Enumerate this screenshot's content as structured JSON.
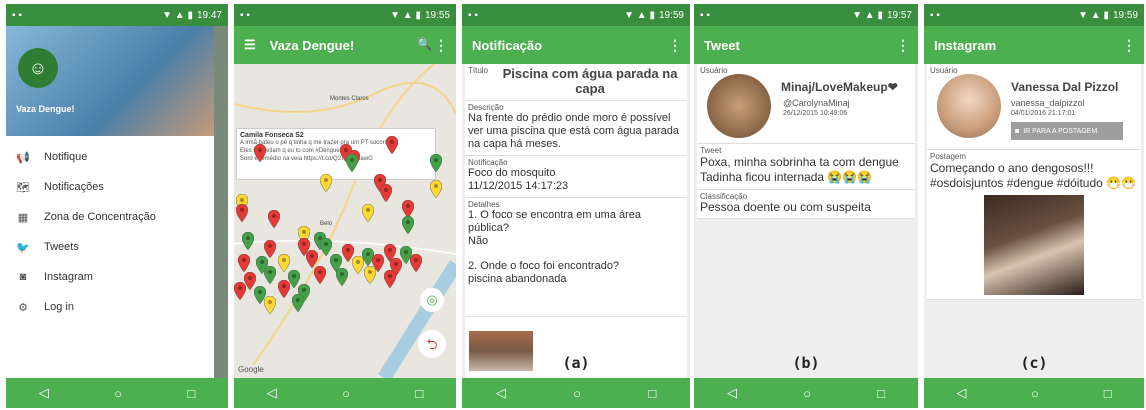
{
  "status_times": [
    "19:47",
    "19:55",
    "19:59",
    "19:57",
    "19:59"
  ],
  "drawer": {
    "app_name": "Vaza Dengue!",
    "items": [
      {
        "label": "Notifique",
        "icon": "megaphone-icon"
      },
      {
        "label": "Notificações",
        "icon": "map-list-icon"
      },
      {
        "label": "Zona de Concentração",
        "icon": "zone-map-icon"
      },
      {
        "label": "Tweets",
        "icon": "twitter-icon"
      },
      {
        "label": "Instagram",
        "icon": "instagram-icon"
      },
      {
        "label": "Log in",
        "icon": "gear-icon"
      }
    ]
  },
  "map_screen": {
    "title": "Vaza Dengue!",
    "tooltip_user": "Camila Fonseca S2",
    "tooltip_text": "A irmã bateu o pé q tinha q me trazer pra um PT socorro\nEles suspeitam q eu to com #Dengue\nSoro e remédio na veia https://t.co/Q276YGEawG",
    "city_label": "Montes Claros",
    "city_label2": "Belo"
  },
  "notification": {
    "title": "Notificação",
    "titulo_label": "Título",
    "titulo": "Piscina com água parada na capa",
    "descricao_label": "Descrição",
    "descricao": "Na frente do prédio onde moro é possível ver uma piscina que está com água parada na capa há meses.",
    "notificacao_label": "Notificação",
    "notificacao_type": "Foco do mosquito",
    "notificacao_date": "11/12/2015 14:17:23",
    "detalhes_label": "Detalhes",
    "detalhe_q1": "1. O foco se encontra em uma área pública?",
    "detalhe_a1": "Não",
    "detalhe_q2": "2. Onde o foco foi encontrado?",
    "detalhe_a2": "piscina abandonada",
    "caption": "(a)"
  },
  "tweet": {
    "title": "Tweet",
    "usuario_label": "Usuário",
    "name": "Minaj/LoveMakeup❤",
    "handle": "@CarolynaMinaj",
    "date": "26/12/2015 10:49:06",
    "tweet_label": "Tweet",
    "text_line1": "Poxa, minha sobrinha ta com dengue",
    "text_line2": "Tadinha ficou internada 😭😭😭",
    "classificacao_label": "Classificação",
    "classificacao": "Pessoa doente ou com suspeita",
    "caption": "(b)"
  },
  "instagram": {
    "title": "Instagram",
    "usuario_label": "Usuário",
    "name": "Vanessa Dal Pizzol",
    "handle": "vanessa_dalpizzol",
    "date": "04/01/2016 21:17:01",
    "button": "IR PARA A POSTAGEM",
    "postagem_label": "Postagem",
    "text": "Começando o ano dengosos!!! #osdoisjuntos #dengue #dóitudo 😷😷",
    "caption": "(c)"
  },
  "colors": {
    "primary": "#4caf50",
    "status": "#388e3c",
    "pin_red": "#e53935",
    "pin_green": "#43a047",
    "pin_yellow": "#fdd835"
  }
}
